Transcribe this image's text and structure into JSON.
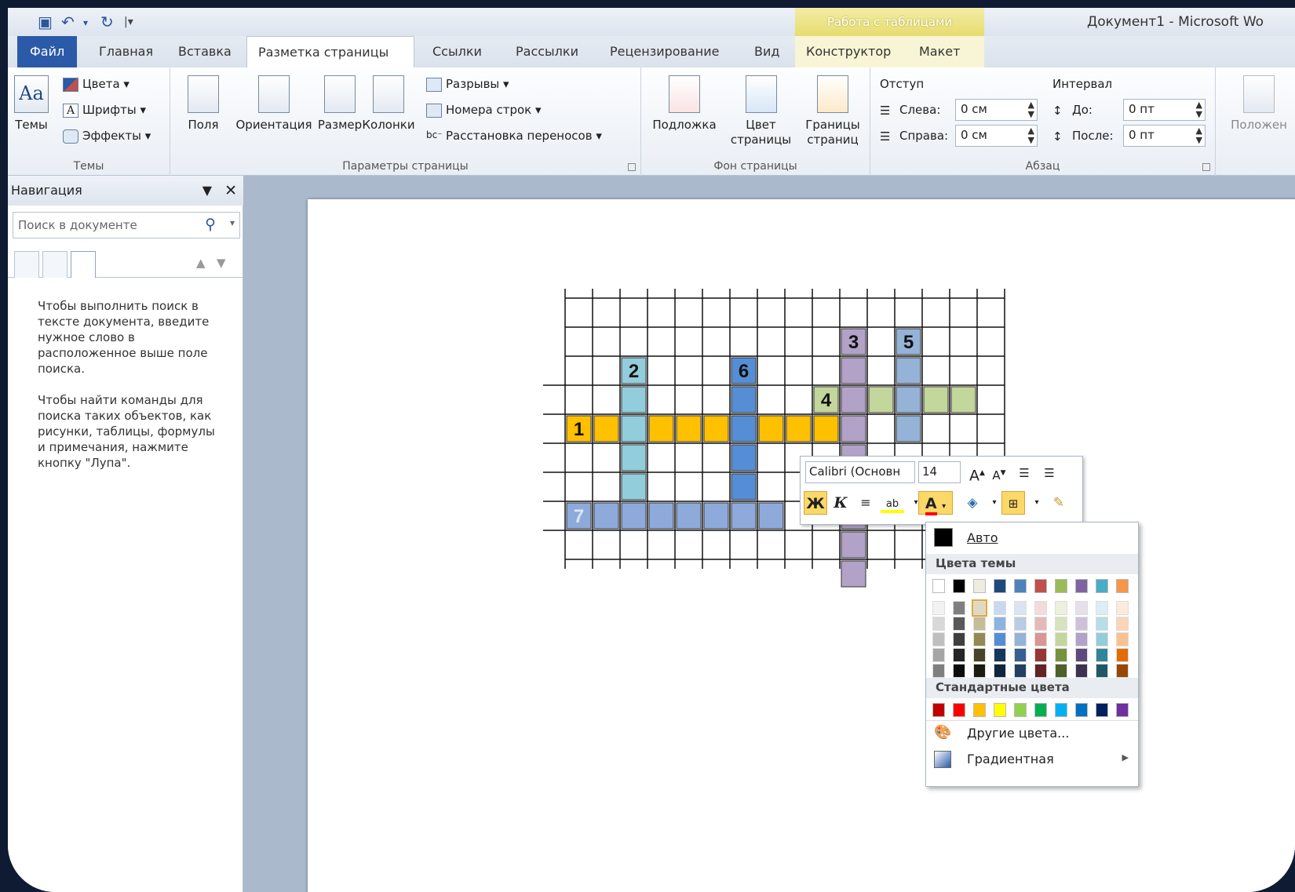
{
  "app": {
    "title": "Документ1 - Microsoft Wo",
    "context_tab_header": "Работа с таблицами"
  },
  "tabs": [
    {
      "label": "Файл"
    },
    {
      "label": "Главная"
    },
    {
      "label": "Вставка"
    },
    {
      "label": "Разметка страницы"
    },
    {
      "label": "Ссылки"
    },
    {
      "label": "Рассылки"
    },
    {
      "label": "Рецензирование"
    },
    {
      "label": "Вид"
    },
    {
      "label": "Конструктор"
    },
    {
      "label": "Макет"
    }
  ],
  "ribbon": {
    "themes": {
      "label": "Темы",
      "big": "Темы",
      "colors": "Цвета",
      "fonts": "Шрифты",
      "effects": "Эффекты"
    },
    "page_setup": {
      "label": "Параметры страницы",
      "margins": "Поля",
      "orientation": "Ориентация",
      "size": "Размер",
      "columns": "Колонки",
      "breaks": "Разрывы",
      "line_numbers": "Номера строк",
      "hyphenation": "Расстановка переносов"
    },
    "page_bg": {
      "label": "Фон страницы",
      "watermark": "Подложка",
      "page_color_1": "Цвет",
      "page_color_2": "страницы",
      "borders_1": "Границы",
      "borders_2": "страниц"
    },
    "paragraph": {
      "label": "Абзац",
      "indent": "Отступ",
      "left": "Слева:",
      "left_val": "0 см",
      "right": "Справа:",
      "right_val": "0 см",
      "spacing": "Интервал",
      "before": "До:",
      "before_val": "0 пт",
      "after": "После:",
      "after_val": "0 пт"
    },
    "arrange": {
      "position": "Положен"
    }
  },
  "nav": {
    "title": "Навигация",
    "search_placeholder": "Поиск в документе",
    "text1": "Чтобы выполнить поиск в тексте документа, введите нужное слово в расположенное выше поле поиска.",
    "text2": "Чтобы найти команды для поиска таких объектов, как рисунки, таблицы, формулы и примечания, нажмите кнопку \"Лупа\"."
  },
  "crossword": {
    "numbers": [
      "1",
      "2",
      "3",
      "4",
      "5",
      "6",
      "7"
    ],
    "colors": {
      "orange": "#ffc000",
      "teal": "#92cddc",
      "blue": "#558ed5",
      "purple": "#b3a2c7",
      "green": "#c3d69b",
      "lightblue": "#95b3d7",
      "slate": "#8eaadb"
    }
  },
  "mini_toolbar": {
    "font": "Calibri (Основн",
    "size": "14",
    "bold": "Ж",
    "italic": "К"
  },
  "palette": {
    "auto": "Авто",
    "theme_header": "Цвета темы",
    "standard_header": "Стандартные цвета",
    "more": "Другие цвета...",
    "gradient": "Градиентная",
    "theme_top": [
      "#ffffff",
      "#000000",
      "#eeece1",
      "#1f497d",
      "#4f81bd",
      "#c0504d",
      "#9bbb59",
      "#8064a2",
      "#4bacc6",
      "#f79646"
    ],
    "theme_shades": [
      [
        "#f2f2f2",
        "#7f7f7f",
        "#ddd9c3",
        "#c6d9f0",
        "#dbe5f1",
        "#f2dcdb",
        "#ebf1dd",
        "#e5e0ec",
        "#dbeef3",
        "#fdeada"
      ],
      [
        "#d8d8d8",
        "#595959",
        "#c4bd97",
        "#8db3e2",
        "#b8cce4",
        "#e5b9b7",
        "#d7e3bc",
        "#ccc1d9",
        "#b7dde8",
        "#fbd5b5"
      ],
      [
        "#bfbfbf",
        "#3f3f3f",
        "#938953",
        "#548dd4",
        "#95b3d7",
        "#d99694",
        "#c3d69b",
        "#b2a2c7",
        "#92cddc",
        "#fac08f"
      ],
      [
        "#a5a5a5",
        "#262626",
        "#494429",
        "#17365d",
        "#366092",
        "#953734",
        "#76923c",
        "#5f497a",
        "#31859b",
        "#e36c09"
      ],
      [
        "#7f7f7f",
        "#0c0c0c",
        "#1d1b10",
        "#0f243e",
        "#244061",
        "#632423",
        "#4f6128",
        "#3f3151",
        "#205867",
        "#974806"
      ]
    ],
    "standard": [
      "#c00000",
      "#ff0000",
      "#ffc000",
      "#ffff00",
      "#92d050",
      "#00b050",
      "#00b0f0",
      "#0070c0",
      "#002060",
      "#7030a0"
    ]
  }
}
